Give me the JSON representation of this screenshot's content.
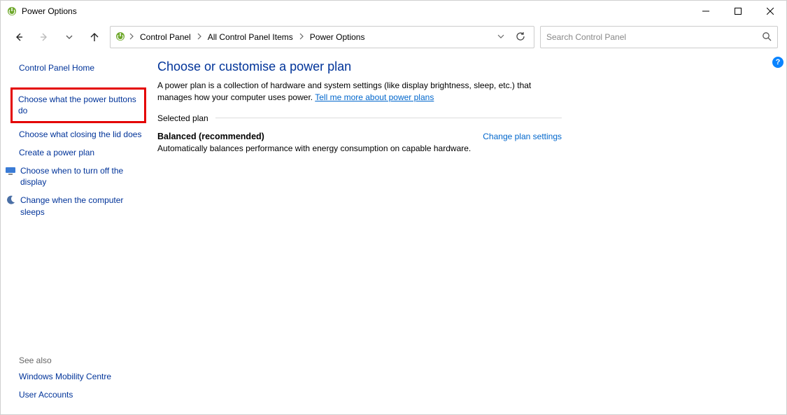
{
  "window": {
    "title": "Power Options"
  },
  "breadcrumb": {
    "items": [
      "Control Panel",
      "All Control Panel Items",
      "Power Options"
    ]
  },
  "search": {
    "placeholder": "Search Control Panel"
  },
  "sidebar": {
    "home": "Control Panel Home",
    "links": [
      "Choose what the power buttons do",
      "Choose what closing the lid does",
      "Create a power plan",
      "Choose when to turn off the display",
      "Change when the computer sleeps"
    ],
    "see_also_title": "See also",
    "see_also": [
      "Windows Mobility Centre",
      "User Accounts"
    ]
  },
  "main": {
    "heading": "Choose or customise a power plan",
    "desc_prefix": "A power plan is a collection of hardware and system settings (like display brightness, sleep, etc.) that manages how your computer uses power. ",
    "desc_link": "Tell me more about power plans",
    "section_label": "Selected plan",
    "plan_name": "Balanced (recommended)",
    "change_plan": "Change plan settings",
    "plan_desc": "Automatically balances performance with energy consumption on capable hardware."
  },
  "help_badge": "?"
}
